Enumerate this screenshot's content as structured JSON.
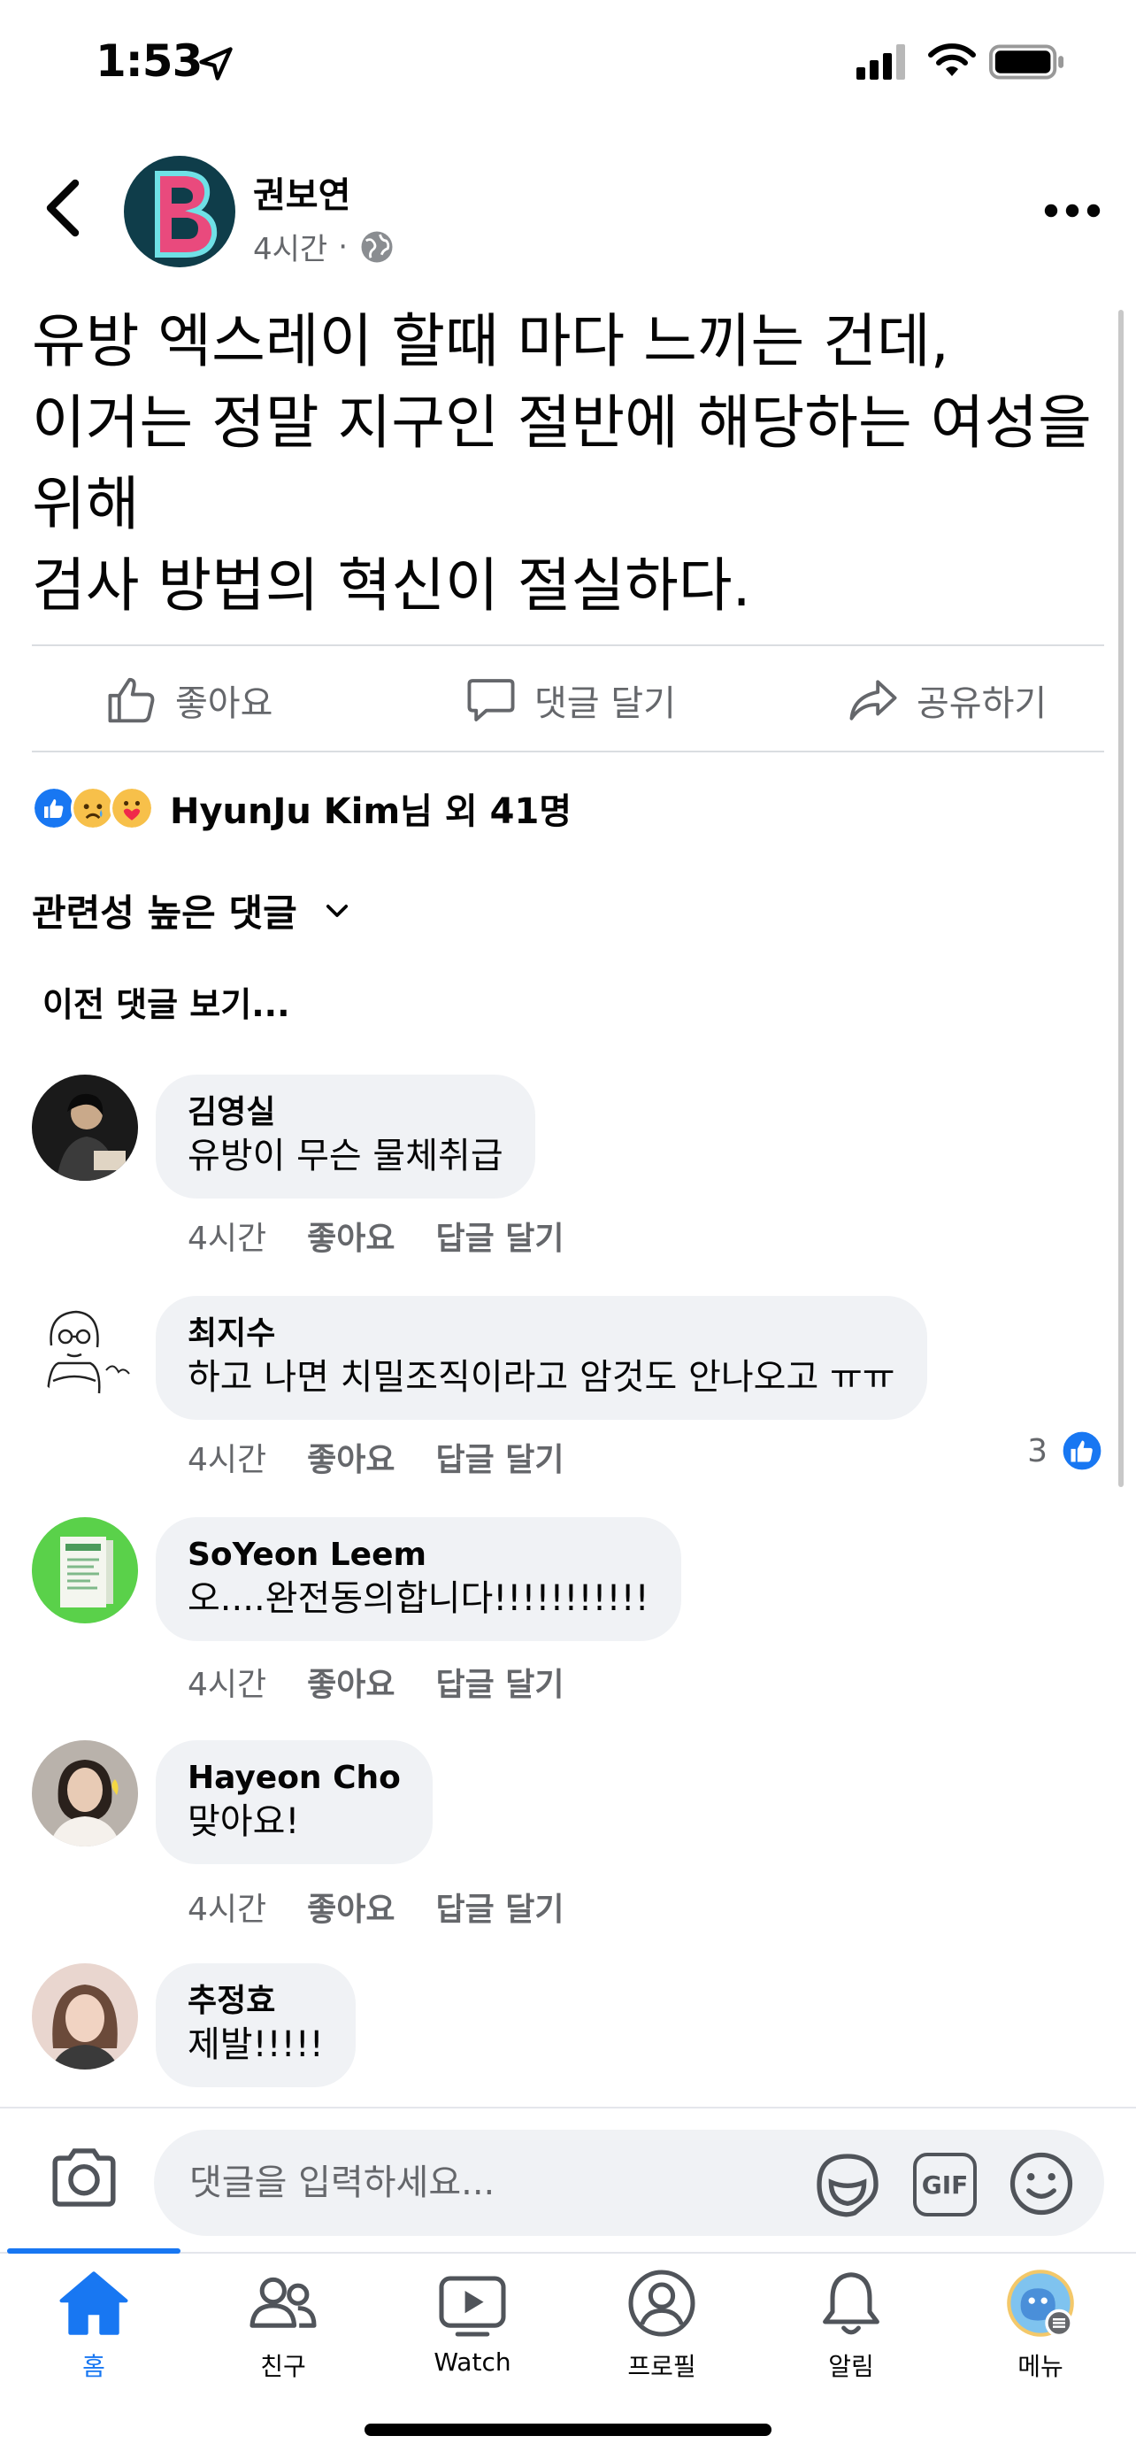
{
  "status_bar": {
    "time": "1:53"
  },
  "post": {
    "author": "권보연",
    "time": "4시간",
    "dot": "·",
    "lines": [
      "유방 엑스레이 할때 마다 느끼는 건데,",
      "이거는 정말 지구인 절반에 해당하는 여성을",
      "위해",
      "검사 방법의 혁신이 절실하다."
    ]
  },
  "actions": {
    "like": "좋아요",
    "comment": "댓글 달기",
    "share": "공유하기"
  },
  "reactions": {
    "summary": "HyunJu Kim님 외 41명"
  },
  "comments_section": {
    "sort_label": "관련성 높은 댓글",
    "previous": "이전 댓글 보기..."
  },
  "comments": [
    {
      "name": "김영실",
      "text": "유방이 무슨 물체취급",
      "time": "4시간",
      "like": "좋아요",
      "reply": "답글 달기"
    },
    {
      "name": "최지수",
      "text": "하고 나면 치밀조직이라고 암것도 안나오고 ㅠㅠ",
      "time": "4시간",
      "like": "좋아요",
      "reply": "답글 달기",
      "reaction_count": "3"
    },
    {
      "name": "SoYeon Leem",
      "text": "오....완전동의합니다!!!!!!!!!!!",
      "time": "4시간",
      "like": "좋아요",
      "reply": "답글 달기"
    },
    {
      "name": "Hayeon Cho",
      "text": "맞아요!",
      "time": "4시간",
      "like": "좋아요",
      "reply": "답글 달기"
    },
    {
      "name": "추정효",
      "text": "제발!!!!!"
    }
  ],
  "composer": {
    "placeholder": "댓글을 입력하세요...",
    "gif": "GIF"
  },
  "tabs": [
    {
      "label": "홈",
      "icon": "home-icon",
      "active": true
    },
    {
      "label": "친구",
      "icon": "friends-icon"
    },
    {
      "label": "Watch",
      "icon": "watch-icon"
    },
    {
      "label": "프로필",
      "icon": "profile-icon"
    },
    {
      "label": "알림",
      "icon": "bell-icon"
    },
    {
      "label": "메뉴",
      "icon": "menu-avatar-icon"
    }
  ],
  "colors": {
    "accent": "#1877f2",
    "secondary_text": "#65676b",
    "bubble": "#f0f2f5"
  }
}
